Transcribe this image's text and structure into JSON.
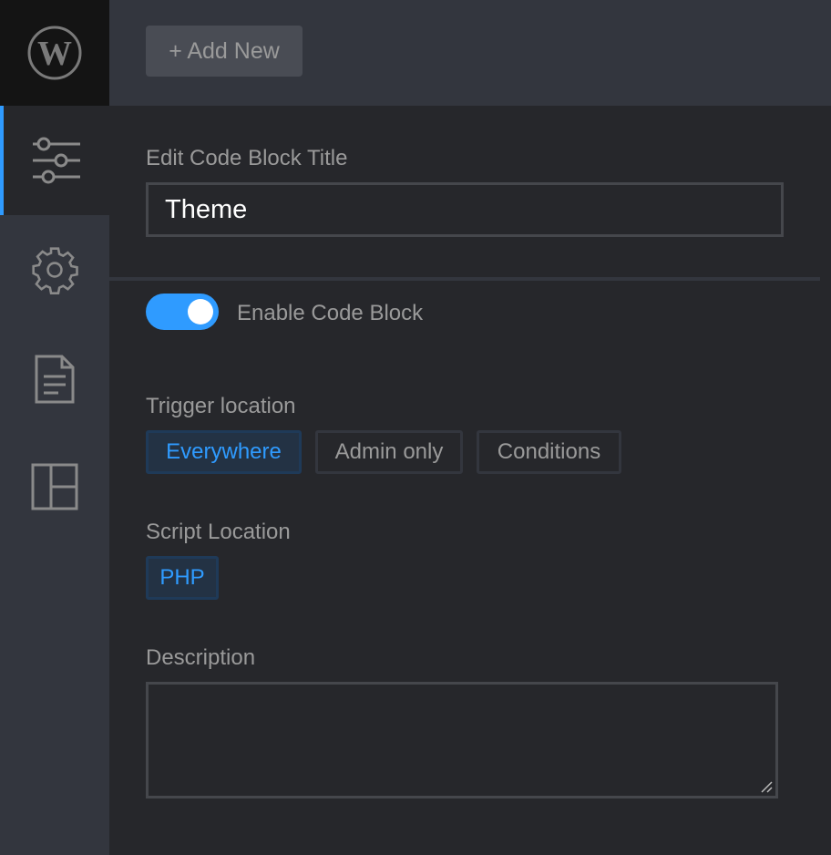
{
  "header": {
    "add_new_label": "+ Add New"
  },
  "sidebar": {
    "items": [
      {
        "icon": "sliders-icon",
        "active": true
      },
      {
        "icon": "gear-icon"
      },
      {
        "icon": "document-icon"
      },
      {
        "icon": "layout-icon"
      }
    ]
  },
  "form": {
    "title_label": "Edit Code Block Title",
    "title_value": "Theme",
    "enable_label": "Enable Code Block",
    "enabled": true,
    "trigger_label": "Trigger location",
    "trigger_options": [
      "Everywhere",
      "Admin only",
      "Conditions"
    ],
    "trigger_selected": "Everywhere",
    "script_label": "Script Location",
    "script_options": [
      "PHP"
    ],
    "description_label": "Description",
    "description_value": ""
  },
  "colors": {
    "accent": "#2f9bff",
    "sidebar": "#33363e",
    "background": "#26272b"
  }
}
